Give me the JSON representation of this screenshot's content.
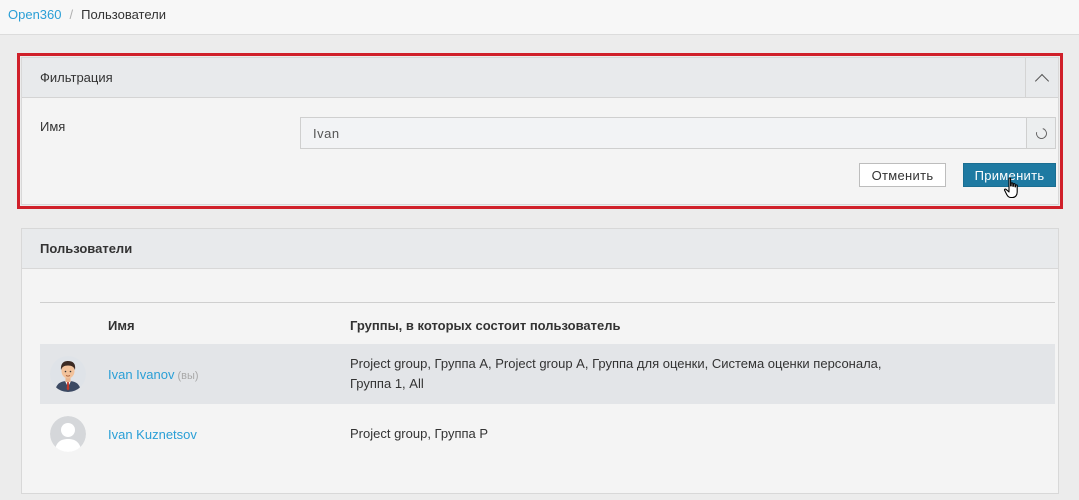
{
  "breadcrumb": {
    "root": "Open360",
    "separator": "/",
    "current": "Пользователи"
  },
  "filter": {
    "title": "Фильтрация",
    "collapse_icon": "chevron-up-icon",
    "name_label": "Имя",
    "name_value": "Ivan",
    "reset_icon": "refresh-icon",
    "cancel_label": "Отменить",
    "apply_label": "Применить",
    "highlight_color": "#d0202a"
  },
  "users": {
    "title": "Пользователи",
    "columns": {
      "name": "Имя",
      "groups": "Группы, в которых состоит пользователь"
    },
    "rows": [
      {
        "avatar": "man-portrait-avatar",
        "name": "Ivan Ivanov",
        "tag": "(вы)",
        "groups_line1": "Project group, Группа А, Project group  А, Группа для оценки, Система оценки персонала,",
        "groups_line2": "Группа 1, All"
      },
      {
        "avatar": "default-avatar-icon",
        "name": "Ivan Kuznetsov",
        "tag": "",
        "groups_line1": "Project group, Группа Р",
        "groups_line2": ""
      }
    ]
  },
  "colors": {
    "link": "#2a9fd6",
    "primary_button": "#1e7aa2",
    "highlighted_row": "#e3e5e8"
  }
}
